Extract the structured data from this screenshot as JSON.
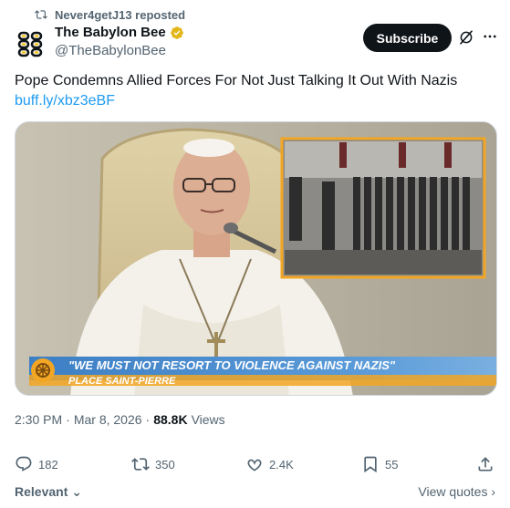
{
  "repost": {
    "text": "Never4getJ13 reposted",
    "icon": "repost-icon"
  },
  "author": {
    "name": "The Babylon Bee",
    "handle": "@TheBabylonBee",
    "verified": "gold-check-icon",
    "avatar": "babylon-bee-logo"
  },
  "header": {
    "subscribe_label": "Subscribe",
    "grok_icon": "grok-icon",
    "more_icon": "more-dots-icon"
  },
  "tweet": {
    "text": "Pope Condemns Allied Forces For Not Just Talking It Out With Nazis",
    "link": "buff.ly/xbz3eBF"
  },
  "media": {
    "caption_main": "\"WE MUST NOT RESORT TO VIOLENCE AGAINST NAZIS\"",
    "caption_sub": "PLACE SAINT-PIERRE"
  },
  "meta": {
    "time": "2:30 PM",
    "sep": "·",
    "date": "Mar 8, 2026",
    "sep2": "·",
    "views": "88.8K",
    "views_label": "Views"
  },
  "actions": {
    "replies": "182",
    "reposts": "350",
    "likes": "2.4K",
    "bookmarks": "55"
  },
  "footer": {
    "relevant": "Relevant",
    "view_quotes": "View quotes"
  },
  "colors": {
    "accent": "#1d9bf0",
    "text": "#0f1419",
    "muted": "#536471",
    "gold": "#e2b719",
    "caption_bar": "#4f8fd0"
  }
}
